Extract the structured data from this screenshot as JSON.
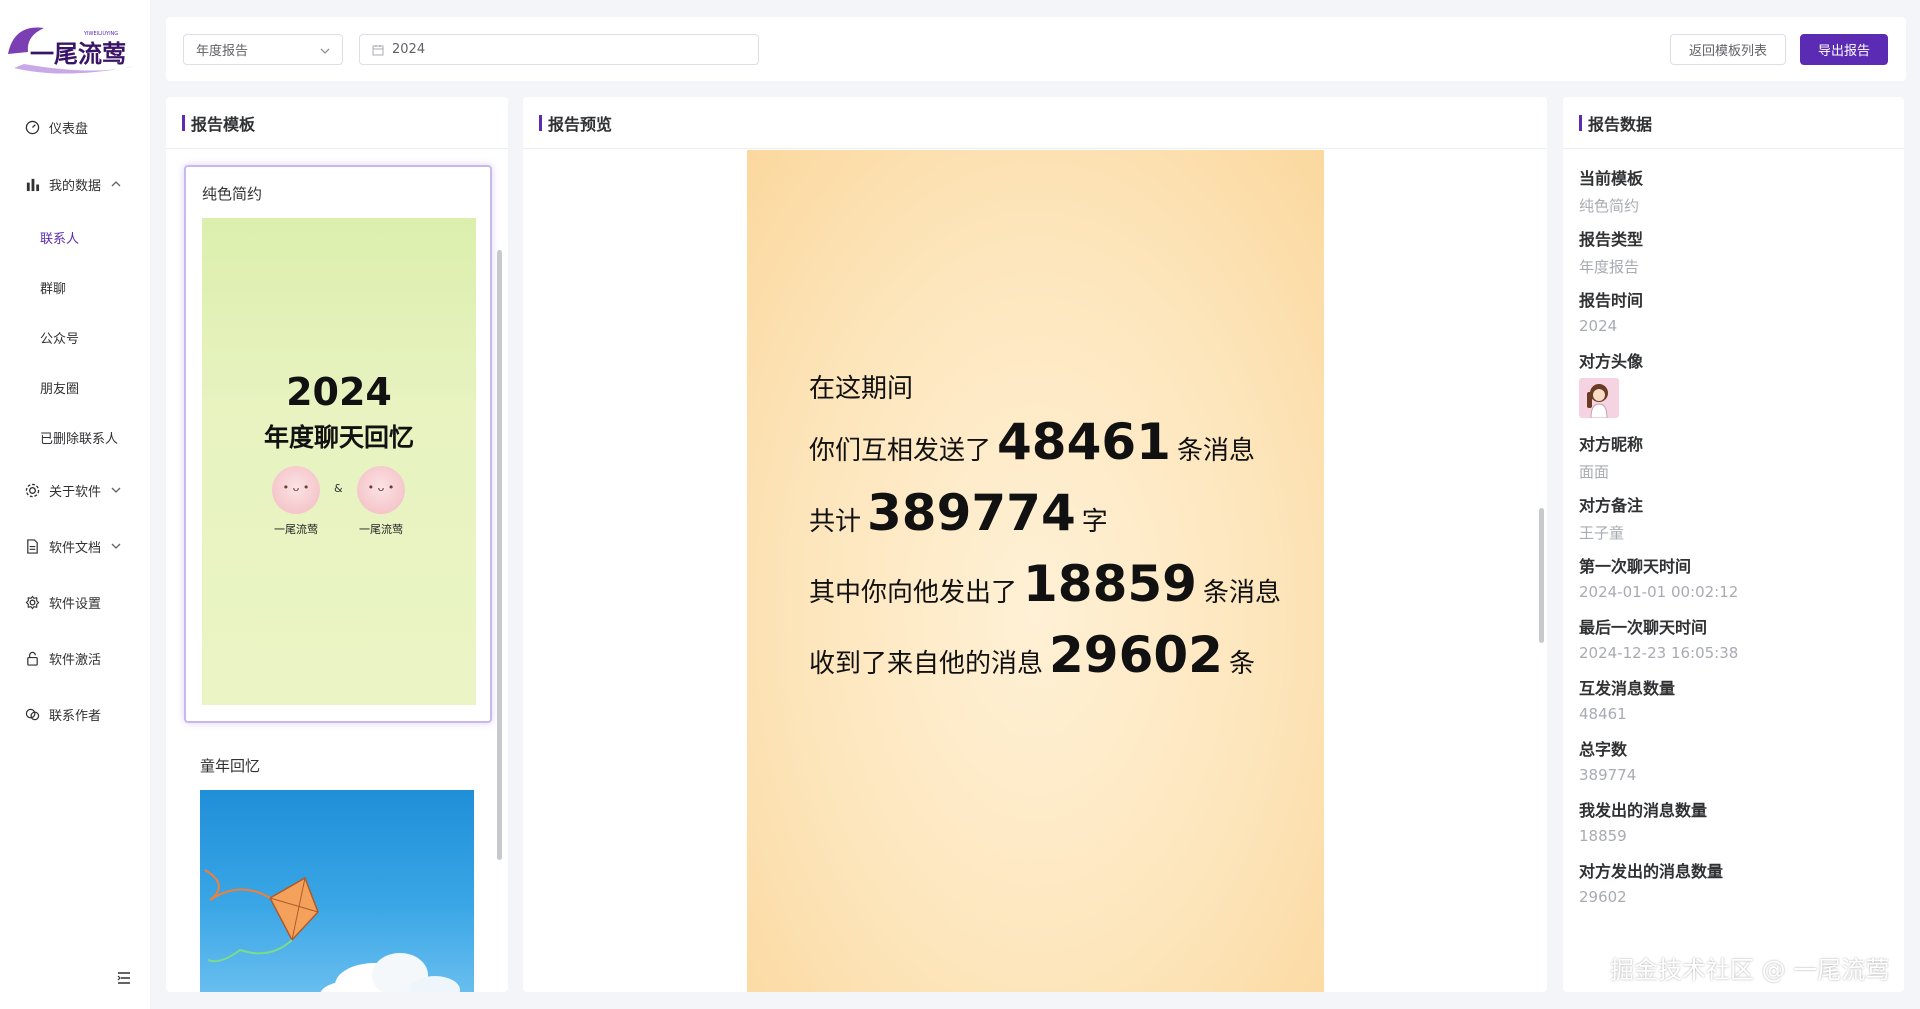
{
  "app": {
    "logo_text": "一尾流莺",
    "logo_small": "YIWEILIUYING"
  },
  "sidebar": {
    "items": [
      {
        "label": "仪表盘",
        "icon": "dashboard-icon"
      },
      {
        "label": "我的数据",
        "icon": "bar-chart-icon"
      },
      {
        "label": "关于软件",
        "icon": "settings-cog-icon"
      },
      {
        "label": "软件文档",
        "icon": "document-icon"
      },
      {
        "label": "软件设置",
        "icon": "gear-icon"
      },
      {
        "label": "软件激活",
        "icon": "lock-icon"
      },
      {
        "label": "联系作者",
        "icon": "chat-icon"
      }
    ],
    "sub_items": [
      "联系人",
      "群聊",
      "公众号",
      "朋友圈",
      "已删除联系人"
    ],
    "active_sub": "联系人"
  },
  "toolbar": {
    "report_type": "年度报告",
    "year": "2024",
    "back_label": "返回模板列表",
    "export_label": "导出报告"
  },
  "left_panel": {
    "title": "报告模板",
    "templates": [
      {
        "name": "纯色简约",
        "cover_year": "2024",
        "cover_title": "年度聊天回忆",
        "amp": "&",
        "name_a": "一尾流莺",
        "name_b": "一尾流莺"
      },
      {
        "name": "童年回忆"
      }
    ]
  },
  "center_panel": {
    "title": "报告预览",
    "report": {
      "line1": "在这期间",
      "line2_pre": "你们互相发送了",
      "line2_num": "48461",
      "line2_post": "条消息",
      "line3_pre": "共计",
      "line3_num": "389774",
      "line3_post": "字",
      "line4_pre": "其中你向他发出了",
      "line4_num": "18859",
      "line4_post": "条消息",
      "line5_pre": "收到了来自他的消息",
      "line5_num": "29602",
      "line5_post": "条"
    }
  },
  "right_panel": {
    "title": "报告数据",
    "fields": [
      {
        "label": "当前模板",
        "value": "纯色简约"
      },
      {
        "label": "报告类型",
        "value": "年度报告"
      },
      {
        "label": "报告时间",
        "value": "2024"
      },
      {
        "label": "对方头像",
        "value": ""
      },
      {
        "label": "对方昵称",
        "value": "面面"
      },
      {
        "label": "对方备注",
        "value": "王子童"
      },
      {
        "label": "第一次聊天时间",
        "value": "2024-01-01 00:02:12"
      },
      {
        "label": "最后一次聊天时间",
        "value": "2024-12-23 16:05:38"
      },
      {
        "label": "互发消息数量",
        "value": "48461"
      },
      {
        "label": "总字数",
        "value": "389774"
      },
      {
        "label": "我发出的消息数量",
        "value": "18859"
      },
      {
        "label": "对方发出的消息数量",
        "value": "29602"
      }
    ]
  },
  "watermark": "掘金技术社区 @ 一尾流莺",
  "colors": {
    "accent": "#5b2bb3",
    "muted": "#a8abb2"
  }
}
